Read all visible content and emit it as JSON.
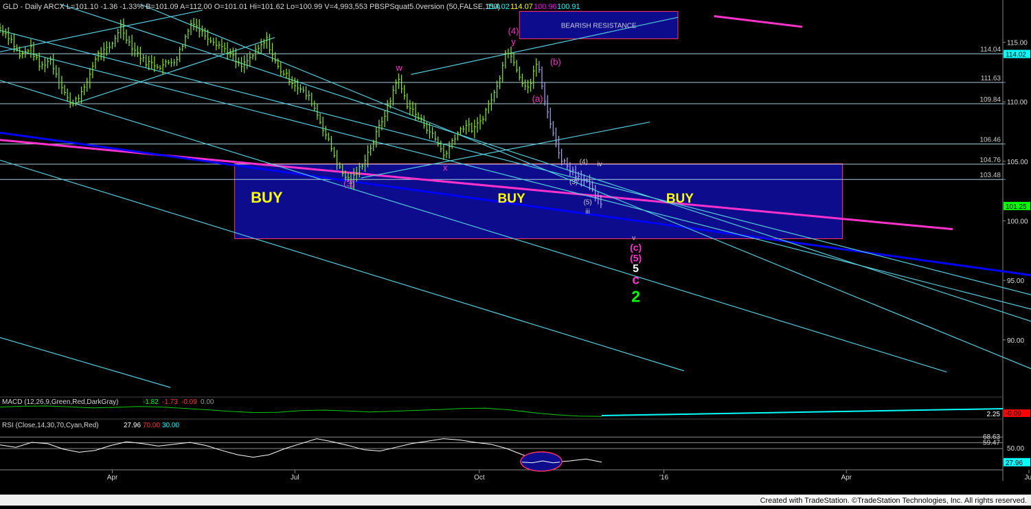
{
  "header": {
    "symbol_text": "GLD - Daily  ARCX  L=101.10  -1.36  -1.33%  B=101.09  A=112.00  O=101.01  Hi=101.62  Lo=100.99  V=4,993,553  PBSPSquat5.0version (50,FALSE,150)",
    "v1": "114.02",
    "v2": "114.07",
    "v3": "100.96",
    "v4": "100.91",
    "v_colors": [
      "#00ffff",
      "#ffff00",
      "#ff00ff",
      "#00ffff"
    ]
  },
  "credit": "Created with TradeStation. ©TradeStation Technologies, Inc. All rights reserved.",
  "colors": {
    "bg": "#000000",
    "bars": "#88ee22",
    "magenta": "#ff33cc",
    "blue": "#0000ff",
    "cyan": "#66cccc",
    "box": "#0c0c8c"
  },
  "chart_data": [
    {
      "type": "line",
      "name": "price",
      "ylim": [
        85.2,
        117.4
      ],
      "y_ticks": [
        90,
        95,
        100,
        105,
        110,
        115
      ],
      "y_tick_labels": [
        "90.00",
        "95.00",
        "100.00",
        "105.00",
        "110.00",
        "115.00"
      ],
      "x_range_days": [
        0,
        500
      ],
      "x_ticks": [
        {
          "label": "Apr",
          "day": 56
        },
        {
          "label": "Jul",
          "day": 147
        },
        {
          "label": "Oct",
          "day": 239
        },
        {
          "label": "'16",
          "day": 331
        },
        {
          "label": "Apr",
          "day": 422
        },
        {
          "label": "Jul",
          "day": 513
        }
      ],
      "price_points": [
        [
          0,
          116.2
        ],
        [
          5,
          115.4
        ],
        [
          10,
          113.8
        ],
        [
          15,
          114.6
        ],
        [
          20,
          112.9
        ],
        [
          25,
          113.6
        ],
        [
          30,
          111.6
        ],
        [
          35,
          109.8
        ],
        [
          42,
          111.0
        ],
        [
          48,
          113.9
        ],
        [
          55,
          114.5
        ],
        [
          60,
          116.4
        ],
        [
          65,
          114.8
        ],
        [
          72,
          113.4
        ],
        [
          80,
          113.0
        ],
        [
          88,
          113.6
        ],
        [
          96,
          116.9
        ],
        [
          100,
          115.9
        ],
        [
          106,
          115.2
        ],
        [
          114,
          114.2
        ],
        [
          120,
          112.9
        ],
        [
          126,
          113.9
        ],
        [
          133,
          115.2
        ],
        [
          138,
          113.0
        ],
        [
          145,
          111.8
        ],
        [
          150,
          111.0
        ],
        [
          155,
          110.2
        ],
        [
          160,
          108.2
        ],
        [
          165,
          106.2
        ],
        [
          170,
          104.1
        ],
        [
          175,
          103.3
        ],
        [
          180,
          104.6
        ],
        [
          186,
          106.6
        ],
        [
          190,
          108.3
        ],
        [
          194,
          109.8
        ],
        [
          198,
          112.1
        ],
        [
          203,
          109.8
        ],
        [
          208,
          108.8
        ],
        [
          214,
          107.6
        ],
        [
          218,
          106.6
        ],
        [
          222,
          105.4
        ],
        [
          226,
          107.0
        ],
        [
          232,
          108.1
        ],
        [
          236,
          107.6
        ],
        [
          240,
          108.5
        ],
        [
          244,
          109.9
        ],
        [
          248,
          111.3
        ],
        [
          252,
          114.3
        ],
        [
          256,
          113.6
        ],
        [
          260,
          111.8
        ],
        [
          264,
          111.2
        ],
        [
          268,
          113.6
        ],
        [
          271,
          110.3
        ],
        [
          274,
          108.6
        ],
        [
          277,
          106.6
        ],
        [
          280,
          105.2
        ],
        [
          284,
          104.4
        ],
        [
          288,
          103.8
        ],
        [
          292,
          103.4
        ],
        [
          295,
          102.6
        ],
        [
          300,
          101.1
        ]
      ],
      "hlines": [
        {
          "value": 114.04,
          "label": "114.04"
        },
        {
          "value": 111.63,
          "label": "111.63"
        },
        {
          "value": 109.84,
          "label": "109.84"
        },
        {
          "value": 106.46,
          "label": "106.46"
        },
        {
          "value": 104.76,
          "label": "104.76"
        },
        {
          "value": 103.48,
          "label": "103.48"
        }
      ],
      "last_price_tags": [
        {
          "value": 114.02,
          "label": "114.02",
          "bg": "#00ffff",
          "fg": "#000000"
        },
        {
          "value": 101.25,
          "label": "101.25",
          "bg": "#00ff00",
          "fg": "#000000"
        }
      ],
      "buy_zone": {
        "x0": 117,
        "x1": 420,
        "y0": 98.5,
        "y1": 104.8,
        "labels": [
          "BUY",
          "BUY",
          "BUY"
        ],
        "label_days": [
          133,
          255,
          339
        ],
        "label_value": 102.0
      },
      "resistance_zone": {
        "x0": 259,
        "x1": 338,
        "y0": 115.3,
        "y1": 117.6,
        "label": "BEARISH RESISTANCE"
      },
      "trendlines": [
        {
          "color": "#ff33cc",
          "width": 3,
          "p1": [
            0,
            106.8
          ],
          "p2": [
            475,
            99.3
          ]
        },
        {
          "color": "#0000ff",
          "width": 3,
          "p1": [
            0,
            107.4
          ],
          "p2": [
            537,
            94.9
          ]
        },
        {
          "color": "#ff33cc",
          "width": 3,
          "p1": [
            356,
            117.2
          ],
          "p2": [
            400,
            116.3
          ]
        },
        {
          "color": "#55ccdd",
          "width": 1.2,
          "p1": [
            0,
            116.0
          ],
          "p2": [
            537,
            92.8
          ]
        },
        {
          "color": "#55ccdd",
          "width": 1.2,
          "p1": [
            0,
            114.7
          ],
          "p2": [
            537,
            91.6
          ]
        },
        {
          "color": "#55ccdd",
          "width": 1.2,
          "p1": [
            30,
            118.2
          ],
          "p2": [
            537,
            90.3
          ]
        },
        {
          "color": "#55ccdd",
          "width": 1.2,
          "p1": [
            70,
            118.2
          ],
          "p2": [
            537,
            86.0
          ]
        },
        {
          "color": "#55ccdd",
          "width": 1.2,
          "p1": [
            0,
            111.8
          ],
          "p2": [
            472,
            87.3
          ]
        },
        {
          "color": "#55ccdd",
          "width": 1.2,
          "p1": [
            0,
            105.1
          ],
          "p2": [
            341,
            87.4
          ]
        },
        {
          "color": "#55ccdd",
          "width": 1.2,
          "p1": [
            0,
            90.2
          ],
          "p2": [
            85,
            86.0
          ]
        },
        {
          "color": "#55ccdd",
          "width": 1.2,
          "p1": [
            0,
            114.2
          ],
          "p2": [
            101,
            117.7
          ]
        },
        {
          "color": "#55ccdd",
          "width": 1.2,
          "p1": [
            38,
            109.9
          ],
          "p2": [
            137,
            115.4
          ]
        },
        {
          "color": "#55ccdd",
          "width": 1.2,
          "p1": [
            205,
            112.3
          ],
          "p2": [
            338,
            117.1
          ]
        },
        {
          "color": "#55ccdd",
          "width": 1.2,
          "p1": [
            180,
            103.6
          ],
          "p2": [
            324,
            108.3
          ]
        }
      ],
      "annotations": [
        {
          "text": "(4)",
          "day": 256,
          "value": 115.7,
          "color": "#ff33cc",
          "size": 13
        },
        {
          "text": "y",
          "day": 256,
          "value": 114.8,
          "color": "#ff33cc",
          "size": 13
        },
        {
          "text": "(b)",
          "day": 277,
          "value": 113.1,
          "color": "#ff33cc",
          "size": 13
        },
        {
          "text": "w",
          "day": 199,
          "value": 112.6,
          "color": "#ff33cc",
          "size": 13
        },
        {
          "text": "(a)",
          "day": 268,
          "value": 110.0,
          "color": "#ff33cc",
          "size": 13
        },
        {
          "text": "x",
          "day": 222,
          "value": 104.2,
          "color": "#ff33cc",
          "size": 13
        },
        {
          "text": "(3)",
          "day": 174,
          "value": 102.9,
          "color": "#ff33cc",
          "size": 13
        },
        {
          "text": "(4)",
          "day": 291,
          "value": 104.8,
          "color": "#cccccc",
          "size": 10
        },
        {
          "text": "iv",
          "day": 299,
          "value": 104.6,
          "color": "#cccccc",
          "size": 10
        },
        {
          "text": "(3)",
          "day": 286,
          "value": 103.1,
          "color": "#cccccc",
          "size": 10
        },
        {
          "text": "(5)",
          "day": 293,
          "value": 101.4,
          "color": "#cccccc",
          "size": 10
        },
        {
          "text": "iii",
          "day": 293,
          "value": 100.6,
          "color": "#cccccc",
          "size": 10
        },
        {
          "text": "v",
          "day": 316,
          "value": 98.4,
          "color": "#cccccc",
          "size": 10
        },
        {
          "text": "(c)",
          "day": 317,
          "value": 97.5,
          "color": "#ff33cc",
          "size": 14
        },
        {
          "text": "(5)",
          "day": 317,
          "value": 96.6,
          "color": "#ff33cc",
          "size": 14
        },
        {
          "text": "5",
          "day": 317,
          "value": 95.7,
          "color": "#ffffff",
          "size": 16
        },
        {
          "text": "c",
          "day": 317,
          "value": 94.7,
          "color": "#ff33cc",
          "size": 19
        },
        {
          "text": "2",
          "day": 317,
          "value": 93.2,
          "color": "#00ff00",
          "size": 23
        }
      ]
    },
    {
      "type": "line",
      "name": "MACD",
      "label": "MACD (12,26,9,Green,Red,DarkGray)",
      "values_text": [
        "-1.82",
        "-1.73",
        "-0.09",
        "0.00"
      ],
      "value_colors": [
        "#00ff00",
        "#ff3333",
        "#ff3333",
        "#999999"
      ],
      "right_labels": [
        {
          "text": "2.25",
          "bg": "#000000",
          "fg": "#ffffff"
        },
        {
          "text": "-0.09",
          "bg": "#ff0000",
          "fg": "#000000"
        }
      ],
      "series": [
        {
          "values": [
            1.6,
            1.9,
            2.0,
            1.7,
            1.3,
            1.5,
            1.8,
            1.6,
            1.1,
            0.6,
            0.0,
            -0.4,
            -0.3,
            0.3,
            0.5,
            0.2,
            -0.2,
            0.1,
            0.4,
            0.7,
            1.1,
            1.2,
            0.6,
            -0.4,
            -1.2,
            -1.7,
            -1.8
          ]
        }
      ]
    },
    {
      "type": "line",
      "name": "RSI",
      "label": "RSI (Close,14,30,70,Cyan,Red)",
      "values_text": [
        "27.96",
        "70.00",
        "30.00"
      ],
      "value_colors": [
        "#ffffff",
        "#ff3333",
        "#00ffff"
      ],
      "ylim": [
        20,
        80
      ],
      "right_labels": [
        {
          "text": "68.63"
        },
        {
          "text": "59.47"
        },
        {
          "text": "50.00"
        },
        {
          "text": "27.96"
        }
      ],
      "series": [
        {
          "values": [
            56,
            52,
            60,
            58,
            49,
            44,
            47,
            55,
            61,
            58,
            54,
            57,
            60,
            55,
            47,
            40,
            36,
            40,
            50,
            58,
            66,
            61,
            55,
            48,
            46,
            52,
            58,
            62,
            66,
            64,
            60,
            57,
            50,
            40,
            32,
            28,
            30,
            33,
            28
          ]
        }
      ]
    }
  ]
}
